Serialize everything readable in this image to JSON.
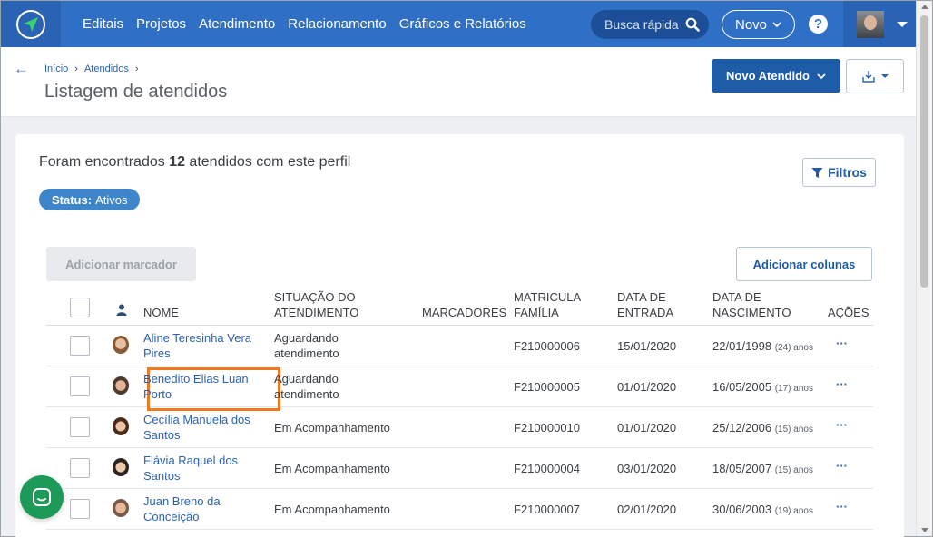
{
  "nav": {
    "items": [
      "Editais",
      "Projetos",
      "Atendimento",
      "Relacionamento",
      "Gráficos e Relatórios"
    ],
    "search_placeholder": "Busca rápida",
    "new_label": "Novo",
    "help_label": "?"
  },
  "header": {
    "breadcrumb": [
      "Início",
      "Atendidos"
    ],
    "title": "Listagem de atendidos",
    "primary_button": "Novo Atendido"
  },
  "summary": {
    "prefix": "Foram encontrados ",
    "count": "12",
    "suffix": " atendidos com este perfil",
    "status_key": "Status:",
    "status_value": "Ativos",
    "filters_label": "Filtros",
    "add_marker_label": "Adicionar marcador",
    "add_columns_label": "Adicionar colunas"
  },
  "table": {
    "columns": {
      "name": "NOME",
      "situation_1": "SITUAÇÃO DO",
      "situation_2": "ATENDIMENTO",
      "markers": "MARCADORES",
      "matricula_1": "MATRICULA",
      "matricula_2": "FAMÍLIA",
      "entry_1": "DATA DE",
      "entry_2": "ENTRADA",
      "birth_1": "DATA DE",
      "birth_2": "NASCIMENTO",
      "actions": "AÇÕES"
    },
    "rows": [
      {
        "name1": "Aline Teresinha Vera",
        "name2": "Pires",
        "sit1": "Aguardando",
        "sit2": "atendimento",
        "matricula": "F210000006",
        "entry": "15/01/2020",
        "birth": "22/01/1998",
        "age": "(24) anos",
        "actions": "···"
      },
      {
        "name1": "Benedito Elias Luan",
        "name2": "Porto",
        "sit1": "Aguardando",
        "sit2": "atendimento",
        "matricula": "F210000005",
        "entry": "01/01/2020",
        "birth": "16/05/2005",
        "age": "(17) anos",
        "actions": "···"
      },
      {
        "name1": "Cecília Manuela dos",
        "name2": "Santos",
        "sit1": "Em Acompanhamento",
        "sit2": "",
        "matricula": "F210000010",
        "entry": "01/01/2020",
        "birth": "25/12/2006",
        "age": "(15) anos",
        "actions": "···"
      },
      {
        "name1": "Flávia Raquel dos",
        "name2": "Santos",
        "sit1": "Em Acompanhamento",
        "sit2": "",
        "matricula": "F210000004",
        "entry": "03/01/2020",
        "birth": "18/05/2007",
        "age": "(15) anos",
        "actions": "···"
      },
      {
        "name1": "Juan Breno da",
        "name2": "Conceição",
        "sit1": "Em Acompanhamento",
        "sit2": "",
        "matricula": "F210000007",
        "entry": "02/01/2020",
        "birth": "30/06/2003",
        "age": "(19) anos",
        "actions": "···"
      }
    ]
  },
  "colors": {
    "nav_bg": "#2f6fc6",
    "primary": "#1f5ca8",
    "link": "#2a63b4",
    "badge": "#3f85c9",
    "highlight": "#f0791f",
    "chat": "#1e9a58"
  }
}
